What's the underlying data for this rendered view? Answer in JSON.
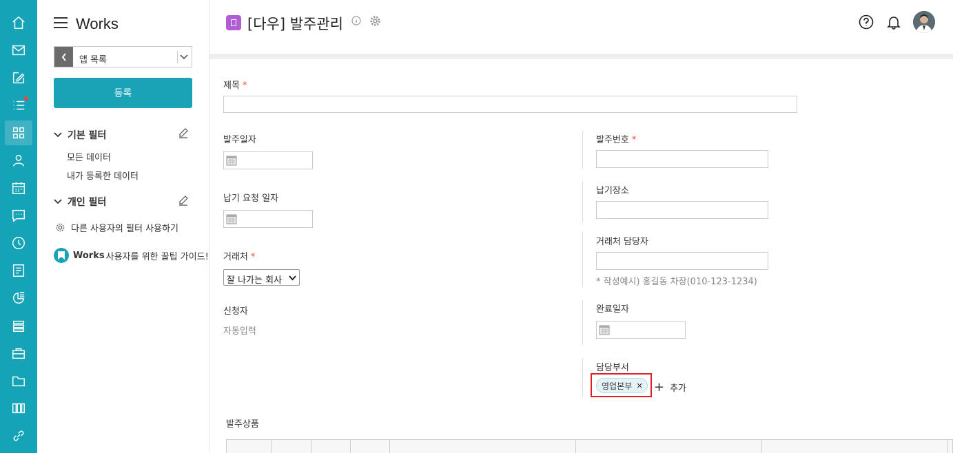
{
  "app": {
    "brand": "Works",
    "title": "[다우] 발주관리"
  },
  "sidebar": {
    "app_select_label": "앱 목록",
    "register_label": "등록",
    "basic_filter_title": "기본 필터",
    "basic_filters": [
      "모든 데이터",
      "내가 등록한 데이터"
    ],
    "personal_filter_title": "개인 필터",
    "other_filter_label": "다른 사용자의 필터 사용하기",
    "guide_brand": "Works",
    "guide_text": "사용자를 위한 꿀팁 가이드!"
  },
  "rail": {
    "icons": [
      "home-icon",
      "mail-icon",
      "write-icon",
      "list-icon",
      "apps-icon",
      "person-icon",
      "calendar-icon",
      "chat-icon",
      "clock-icon",
      "report-icon",
      "chart-icon",
      "board-icon",
      "briefcase-icon",
      "folder-icon",
      "columns-icon",
      "link-icon"
    ],
    "active": "apps-icon",
    "badge_color": "#f44336"
  },
  "form": {
    "title_label": "제목",
    "order_date_label": "발주일자",
    "order_number_label": "발주번호",
    "delivery_date_label": "납기 요청 일자",
    "delivery_place_label": "납기장소",
    "client_label": "거래처",
    "client_value": "잘 나가는 회사",
    "client_contact_label": "거래처 담당자",
    "client_contact_hint": "* 작성예시) 홍길동 차장(010-123-1234)",
    "applicant_label": "신청자",
    "applicant_value": "자동입력",
    "complete_date_label": "완료일자",
    "dept_label": "담당부서",
    "dept_chip": "영업본부",
    "dept_chip_remove": "×",
    "add_label": "추가",
    "products_label": "발주상품"
  },
  "colors": {
    "rail": "#15a3b8",
    "accent": "#1aa3b7",
    "required": "#e94e3a",
    "app_icon": "#b05dd6",
    "highlight": "#e02020"
  }
}
